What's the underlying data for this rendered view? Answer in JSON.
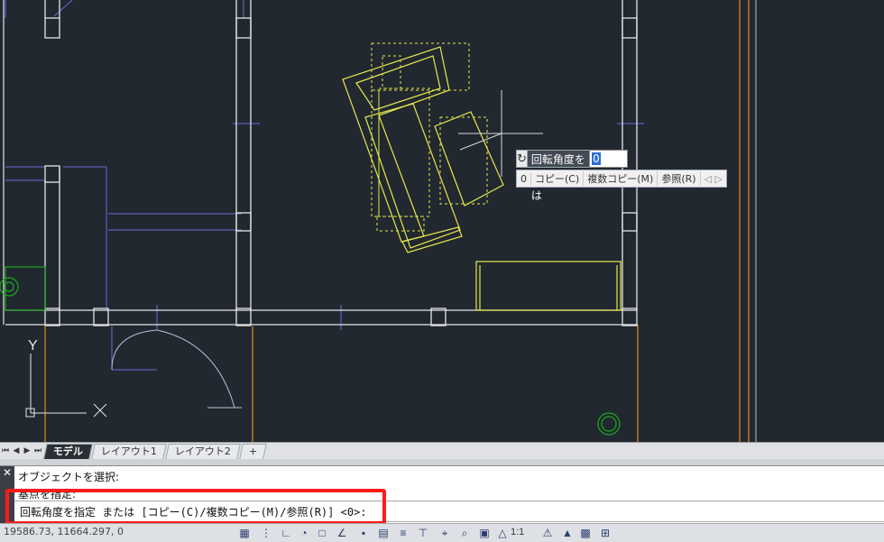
{
  "dynamic_input": {
    "prompt": "回転角度を指定 または",
    "value": "0",
    "options_prefix": "0",
    "options": [
      "コピー(C)",
      "複数コピー(M)",
      "参照(R)"
    ],
    "nav_arrows": "◁ ▷"
  },
  "ucs": {
    "y_label": "Y",
    "x_label": "X"
  },
  "tabs": {
    "nav": [
      "⏮",
      "◀",
      "▶",
      "⏭"
    ],
    "items": [
      {
        "label": "モデル",
        "active": true
      },
      {
        "label": "レイアウト1",
        "active": false
      },
      {
        "label": "レイアウト2",
        "active": false
      },
      {
        "label": "+",
        "active": false
      }
    ]
  },
  "command": {
    "history": [
      "オブジェクトを選択:",
      "基点を指定:"
    ],
    "current": "回転角度を指定 または [コピー(C)/複数コピー(M)/参照(R)] <0>:",
    "close_glyph": "✕"
  },
  "status": {
    "coords": "19586.73, 11664.297, 0",
    "scale": "1:1"
  },
  "colors": {
    "canvas": "#212830",
    "wall": "#e6e6e6",
    "furniture": "#e8e84a",
    "blue_line": "#6c6cd8",
    "orange": "#e88a1c",
    "green": "#1ea81e",
    "highlight": "#ff1a1a"
  }
}
